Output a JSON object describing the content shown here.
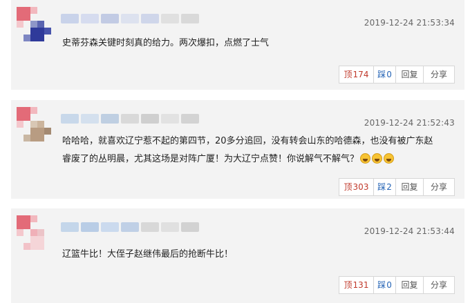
{
  "comments": [
    {
      "timestamp": "2019-12-24 21:53:34",
      "text": "史蒂芬森关键时刻真的给力。两次爆扣，点燃了士气",
      "up_label": "顶",
      "up_count": "174",
      "down_label": "踩",
      "down_count": "0",
      "reply_label": "回复",
      "share_label": "分享"
    },
    {
      "timestamp": "2019-12-24 21:52:43",
      "text_line1": "哈哈哈，就喜欢辽宁惹不起的第四节，20多分追回，没有转会山东的哈德森，也没有被广东赵",
      "text_line2": "睿废了的丛明晨，尤其这场是对阵广厦！为大辽宁点赞！你说解气不解气？",
      "up_label": "顶",
      "up_count": "303",
      "down_label": "踩",
      "down_count": "2",
      "reply_label": "回复",
      "share_label": "分享",
      "emoji_icon": "grinning-face-icon"
    },
    {
      "timestamp": "2019-12-24 21:53:44",
      "text": "辽篮牛比！大侄子赵继伟最后的抢断牛比！",
      "up_label": "顶",
      "up_count": "131",
      "down_label": "踩",
      "down_count": "0",
      "reply_label": "回复",
      "share_label": "分享"
    }
  ],
  "colors": {
    "up": "#c0392b",
    "down": "#2463b5",
    "card_bg": "#f3f3f3",
    "avatar_accent": "#e05566"
  }
}
